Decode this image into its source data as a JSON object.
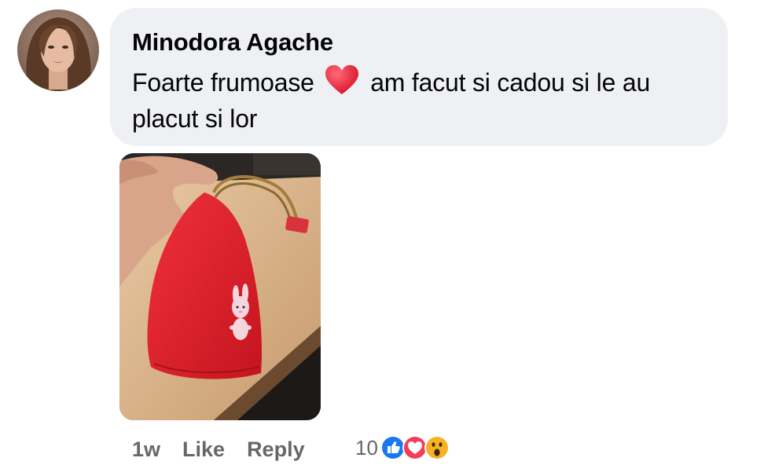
{
  "comment": {
    "author": "Minodora Agache",
    "text_before_emoji": "Foarte frumoase",
    "emoji": "heart-emoji",
    "text_after_emoji": "am facut si cadou si le au placut si lor"
  },
  "actions": {
    "time": "1w",
    "like_label": "Like",
    "reply_label": "Reply"
  },
  "reactions": {
    "count": "10",
    "types": [
      "like-icon",
      "love-icon",
      "wow-icon"
    ]
  },
  "colors": {
    "bubble": "#eef0f3",
    "muted_text": "#65676b",
    "like_blue": "#1877f2",
    "love_red": "#f33e58",
    "wow_yellow": "#f7b125"
  }
}
